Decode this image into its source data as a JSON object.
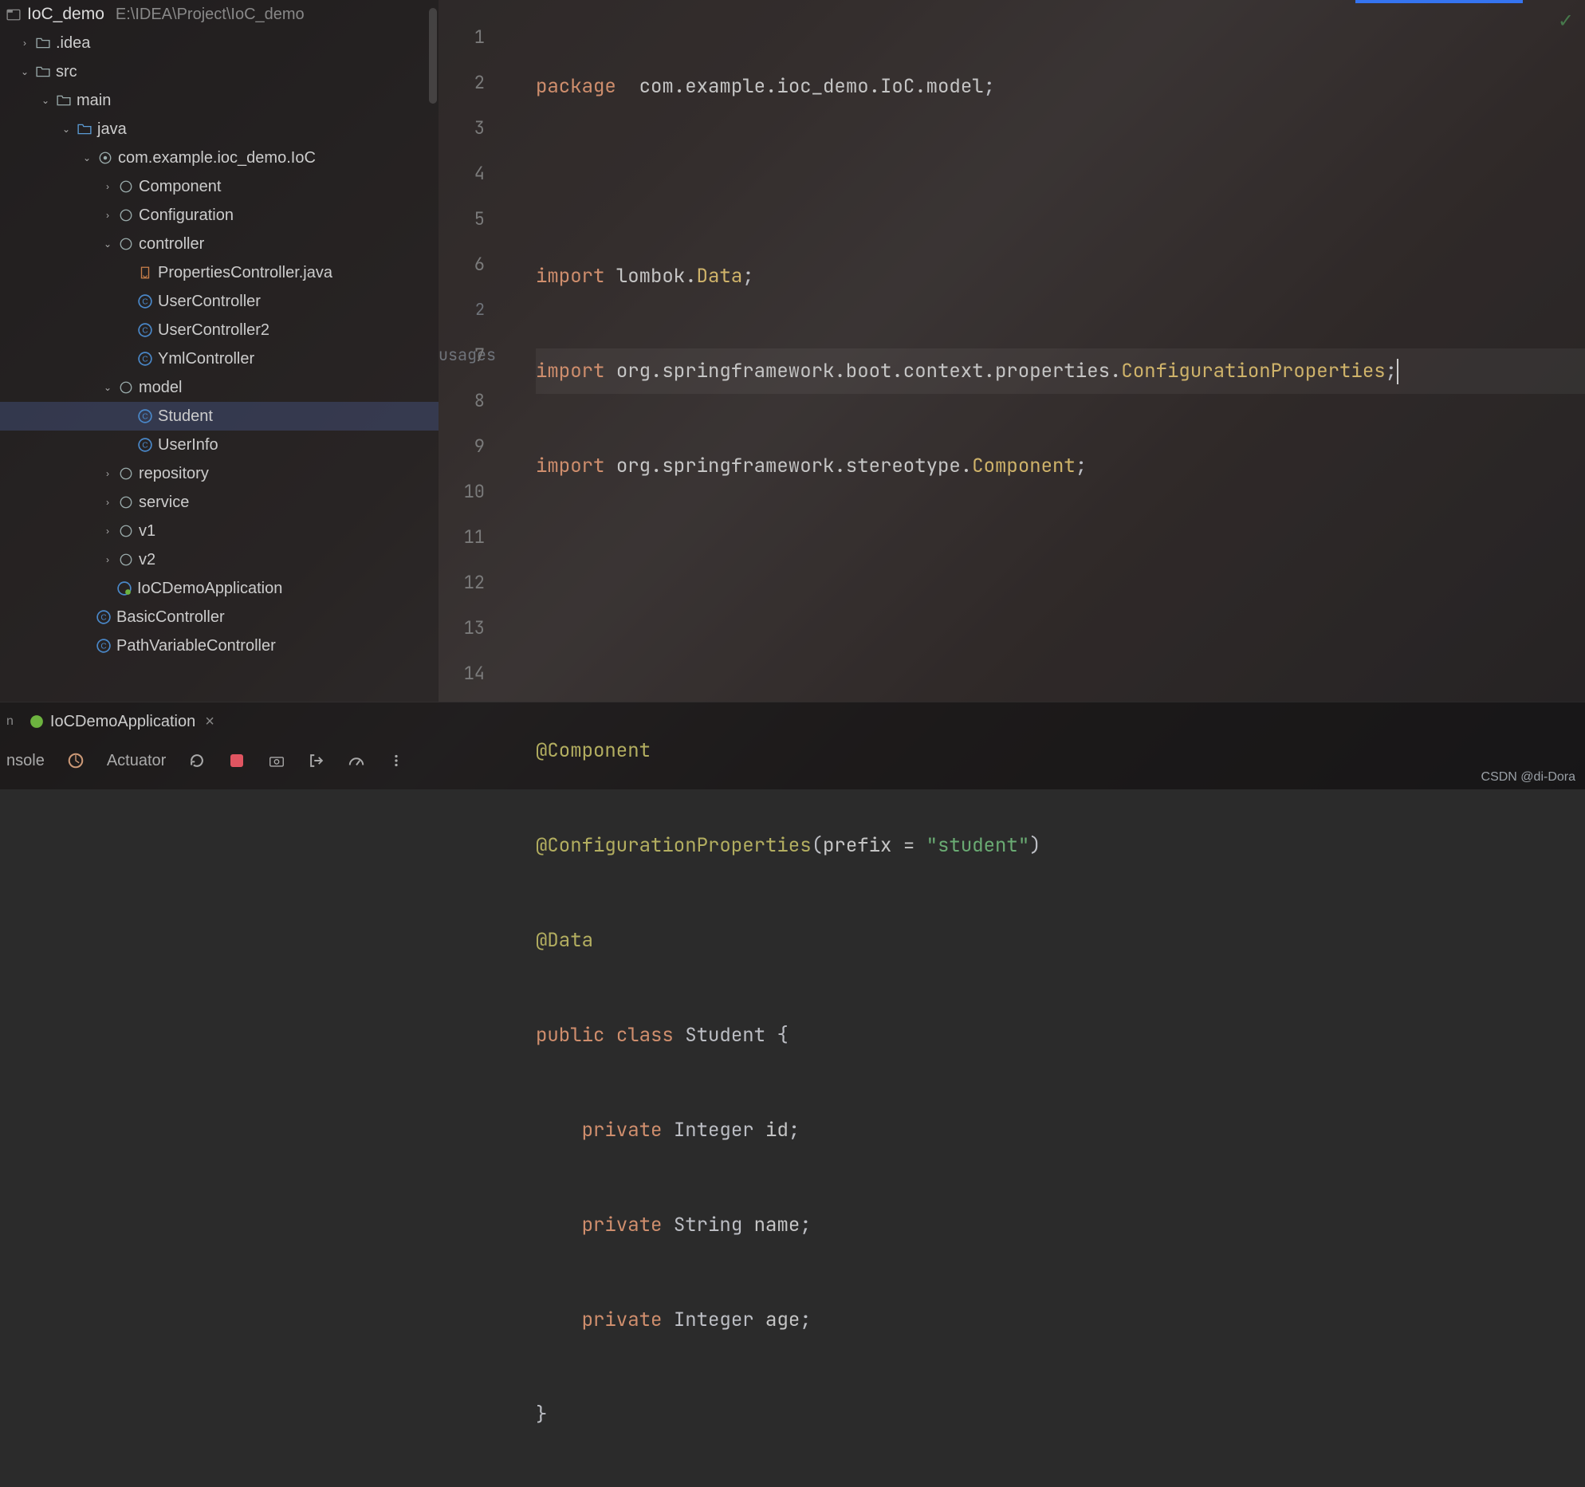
{
  "project": {
    "name": "IoC_demo",
    "path": "E:\\IDEA\\Project\\IoC_demo"
  },
  "tree": {
    "idea": ".idea",
    "src": "src",
    "main": "main",
    "java": "java",
    "pkg": "com.example.ioc_demo.IoC",
    "component": "Component",
    "configuration": "Configuration",
    "controller": "controller",
    "propertiesController": "PropertiesController.java",
    "userController": "UserController",
    "userController2": "UserController2",
    "ymlController": "YmlController",
    "model": "model",
    "student": "Student",
    "userInfo": "UserInfo",
    "repository": "repository",
    "service": "service",
    "v1": "v1",
    "v2": "v2",
    "iocDemoApp": "IoCDemoApplication",
    "basicController": "BasicController",
    "pathVarController": "PathVariableController"
  },
  "editor": {
    "usages_hint": "2 usages",
    "lines": [
      "1",
      "2",
      "3",
      "4",
      "5",
      "6",
      "7",
      "8",
      "9",
      "10",
      "11",
      "12",
      "13",
      "14"
    ],
    "tokens": {
      "package": "package",
      "import": "import",
      "public": "public",
      "class": "class",
      "private": "private",
      "pkg_path": "com.example.ioc_demo.IoC.model",
      "lombok": "lombok.",
      "data": "Data",
      "spring_boot_ctx": "org.springframework.boot.context.properties.",
      "config_props": "ConfigurationProperties",
      "spring_stereo": "org.springframework.stereotype.",
      "component": "Component",
      "ann_component": "@Component",
      "ann_config": "@ConfigurationProperties",
      "ann_data": "@Data",
      "prefix_key": "prefix = ",
      "prefix_val": "\"student\"",
      "student_cls": "Student",
      "integer": "Integer",
      "string": "String",
      "id": "id",
      "name": "name",
      "age": "age"
    }
  },
  "run": {
    "tab": "IoCDemoApplication",
    "console": "nsole",
    "actuator": "Actuator"
  },
  "watermark": "CSDN @di-Dora"
}
